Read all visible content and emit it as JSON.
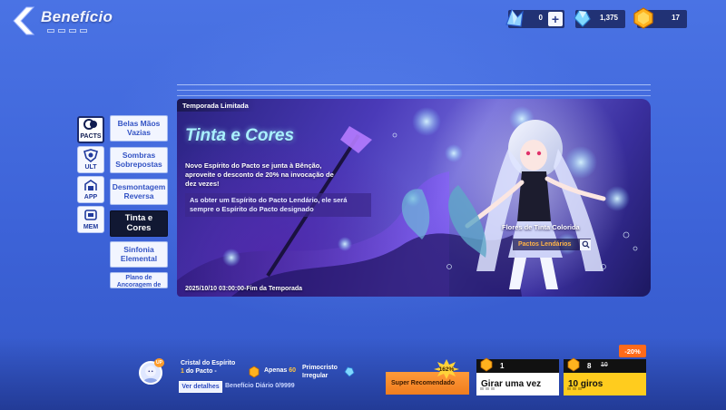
{
  "header": {
    "title": "Benefício"
  },
  "currencies": [
    {
      "icon": "crystal-shard-icon",
      "value": "0"
    },
    {
      "icon": "blue-gem-icon",
      "value": "1,375"
    },
    {
      "icon": "gold-coin-icon",
      "value": "17"
    }
  ],
  "categories": [
    {
      "label": "PACTS",
      "icon": "pact-icon",
      "active": true
    },
    {
      "label": "ULT",
      "icon": "ult-icon",
      "active": false
    },
    {
      "label": "APP",
      "icon": "app-icon",
      "active": false
    },
    {
      "label": "MEM",
      "icon": "mem-icon",
      "active": false
    }
  ],
  "tabs": [
    {
      "label": "Belas Mãos Vazias",
      "active": false
    },
    {
      "label": "Sombras Sobrepostas",
      "active": false
    },
    {
      "label": "Desmontagem Reversa",
      "active": false
    },
    {
      "label": "Tinta e Cores",
      "active": true
    },
    {
      "label": "Sinfonia Elemental",
      "active": false
    },
    {
      "label": "Plano de Ancoragem de",
      "active": false
    }
  ],
  "banner": {
    "season_tag": "Temporada Limitada",
    "title": "Tinta e Cores",
    "description": "Novo Espírito do Pacto se junta à Bênção, aproveite o desconto de 20% na invocação de dez vezes!",
    "note": "As obter um Espírito do Pacto Lendário, ele será sempre o Espírito do Pacto designado",
    "character_name": "Flores de Tinta Colorida",
    "pact_label": "Pactos Lendários",
    "end_date": "2025/10/10 03:00:00-Fim da Temporada"
  },
  "bottom": {
    "avatar_badge": "UP",
    "reward_line1_prefix": "Cristal do Espírito",
    "reward_line1_count": "1",
    "reward_line1_suffix": " do Pacto -",
    "reward_line2_prefix": "Apenas ",
    "reward_line2_count": "60",
    "reward_line3": "Primocristo Irregular",
    "details_button": "Ver detalhes",
    "daily_text": "Benefício Diário 0/9999",
    "super_label": "Super Recomendado",
    "super_pct": "162%",
    "single_roll": {
      "cost": "1",
      "label": "Girar uma vez"
    },
    "ten_roll": {
      "cost": "8",
      "old_cost": "10",
      "label": "10 giros",
      "discount": "-20%"
    }
  }
}
